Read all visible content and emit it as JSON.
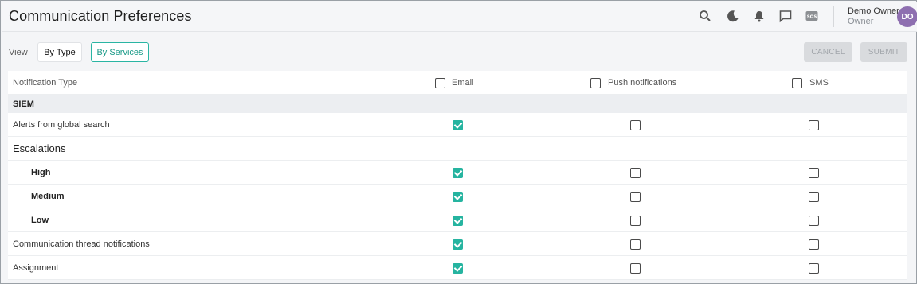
{
  "header": {
    "title": "Communication Preferences",
    "icons": [
      "search-icon",
      "moon-icon",
      "bell-icon",
      "chat-icon",
      "sos-icon"
    ],
    "sos_text": "SOS",
    "user": {
      "name": "Demo Owner",
      "role": "Owner",
      "initials": "DO",
      "avatar_color": "#8e6fb0"
    }
  },
  "toolbar": {
    "view_label": "View",
    "by_type_label": "By Type",
    "by_services_label": "By Services",
    "cancel_label": "CANCEL",
    "submit_label": "SUBMIT"
  },
  "table": {
    "headers": {
      "type": "Notification Type",
      "email": "Email",
      "push": "Push notifications",
      "sms": "SMS"
    },
    "header_checks": {
      "email": false,
      "push": false,
      "sms": false
    },
    "section": "SIEM",
    "rows": [
      {
        "label": "Alerts from global search",
        "kind": "item",
        "email": true,
        "push": false,
        "sms": false
      },
      {
        "label": "Escalations",
        "kind": "group"
      },
      {
        "label": "High",
        "kind": "sub",
        "email": true,
        "push": false,
        "sms": false
      },
      {
        "label": "Medium",
        "kind": "sub",
        "email": true,
        "push": false,
        "sms": false
      },
      {
        "label": "Low",
        "kind": "sub",
        "email": true,
        "push": false,
        "sms": false
      },
      {
        "label": "Communication thread notifications",
        "kind": "item",
        "email": true,
        "push": false,
        "sms": false
      },
      {
        "label": "Assignment",
        "kind": "item",
        "email": true,
        "push": false,
        "sms": false
      }
    ]
  },
  "colors": {
    "accent": "#26b4a0"
  }
}
